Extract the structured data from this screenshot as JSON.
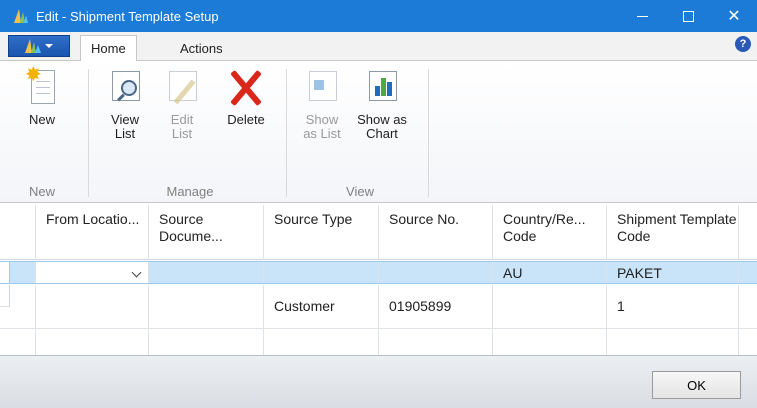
{
  "window": {
    "title": "Edit - Shipment Template Setup",
    "minimize": "—",
    "maximize": "☐",
    "close": "✕"
  },
  "ribbon": {
    "tabs": [
      {
        "label": "Home",
        "active": true
      },
      {
        "label": "Actions",
        "active": false
      }
    ],
    "help_label": "?",
    "groups": [
      {
        "label": "New",
        "buttons": [
          {
            "label": "New",
            "enabled": true
          }
        ]
      },
      {
        "label": "Manage",
        "buttons": [
          {
            "label": "View List",
            "enabled": true
          },
          {
            "label": "Edit List",
            "enabled": false
          },
          {
            "label": "Delete",
            "enabled": true
          }
        ]
      },
      {
        "label": "View",
        "buttons": [
          {
            "label": "Show as List",
            "enabled": false
          },
          {
            "label": "Show as Chart",
            "enabled": true
          }
        ]
      }
    ]
  },
  "grid": {
    "columns": [
      "From Locatio...",
      "Source Docume...",
      "Source Type",
      "Source No.",
      "Country/Re... Code",
      "Shipment Template Code"
    ],
    "rows": [
      {
        "selected": true,
        "cells": [
          "",
          "",
          "",
          "",
          "AU",
          "PAKET"
        ]
      },
      {
        "selected": false,
        "cells": [
          "",
          "",
          "Customer",
          "01905899",
          "",
          "1"
        ]
      },
      {
        "selected": false,
        "cells": [
          "",
          "",
          "",
          "",
          "",
          ""
        ]
      }
    ]
  },
  "footer": {
    "ok_label": "OK"
  },
  "colors": {
    "titlebar": "#1b7bd6",
    "selected_row": "#c9e4f8",
    "delete_icon": "#d9271c"
  }
}
